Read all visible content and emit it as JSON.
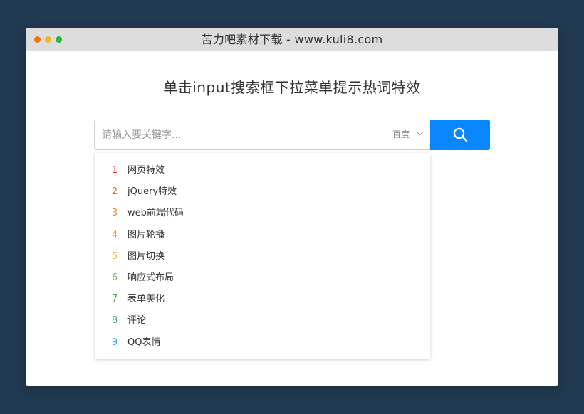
{
  "window": {
    "title": "苦力吧素材下载 - www.kuli8.com"
  },
  "page": {
    "heading": "单击input搜索框下拉菜单提示热词特效"
  },
  "search": {
    "placeholder": "请输入要关键字...",
    "value": "",
    "engine": "百度",
    "button_icon": "search-icon"
  },
  "colors": {
    "page_background": "#223952",
    "accent": "#0a86ff",
    "titlebar": "#dddddd",
    "traffic_lights": [
      "#f4720d",
      "#f3b71c",
      "#2db53a"
    ]
  },
  "suggestions": [
    {
      "rank": "1",
      "term": "网页特效",
      "color": "#e8322f"
    },
    {
      "rank": "2",
      "term": "jQuery特效",
      "color": "#f26a1b"
    },
    {
      "rank": "3",
      "term": "web前端代码",
      "color": "#f08a24"
    },
    {
      "rank": "4",
      "term": "图片轮播",
      "color": "#f0a12a"
    },
    {
      "rank": "5",
      "term": "图片切换",
      "color": "#efb62e"
    },
    {
      "rank": "6",
      "term": "响应式布局",
      "color": "#6cbd45"
    },
    {
      "rank": "7",
      "term": "表单美化",
      "color": "#4cb050"
    },
    {
      "rank": "8",
      "term": "评论",
      "color": "#3bb28a"
    },
    {
      "rank": "9",
      "term": "QQ表情",
      "color": "#3ba9d9"
    }
  ]
}
